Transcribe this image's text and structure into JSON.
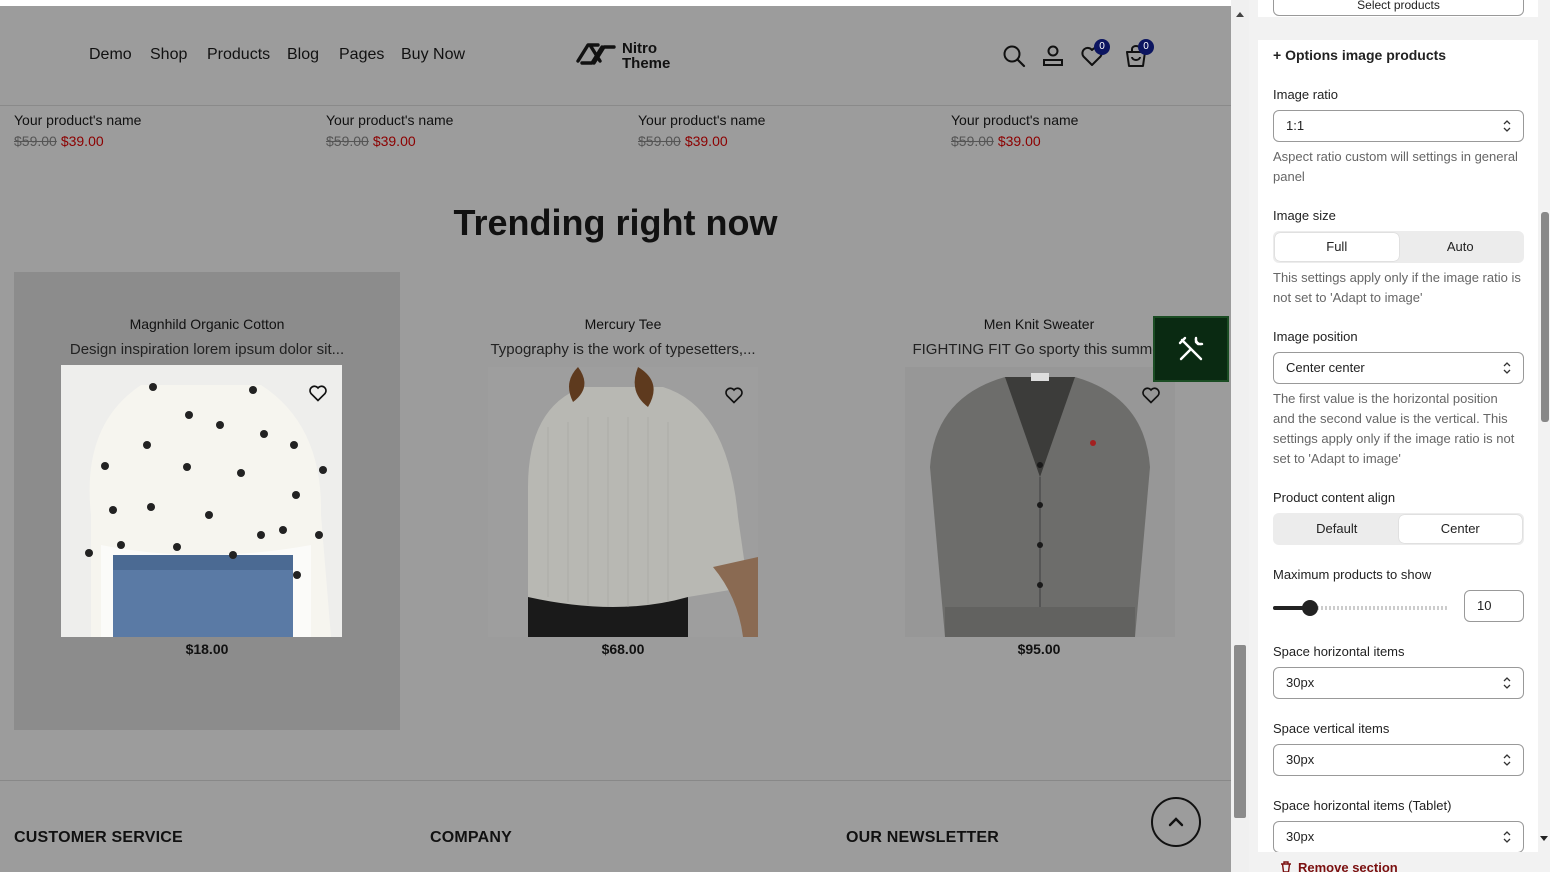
{
  "header": {
    "nav": [
      "Demo",
      "Shop",
      "Products",
      "Blog",
      "Pages",
      "Buy Now"
    ],
    "logo_line1": "Nitro",
    "logo_line2": "Theme",
    "wishlist_count": "0",
    "cart_count": "0",
    "icons": [
      "search-icon",
      "account-icon",
      "wishlist-heart-icon",
      "cart-bag-icon"
    ]
  },
  "top_products": [
    {
      "name": "Your product's name",
      "old_price": "$59.00",
      "price": "$39.00"
    },
    {
      "name": "Your product's name",
      "old_price": "$59.00",
      "price": "$39.00"
    },
    {
      "name": "Your product's name",
      "old_price": "$59.00",
      "price": "$39.00"
    },
    {
      "name": "Your product's name",
      "old_price": "$59.00",
      "price": "$39.00"
    }
  ],
  "trending": {
    "title": "Trending right now",
    "products": [
      {
        "title": "Magnhild Organic Cotton",
        "desc": "Design inspiration lorem ipsum dolor sit...",
        "price": "$18.00"
      },
      {
        "title": "Mercury Tee",
        "desc": "Typography is the work of typesetters,...",
        "price": "$68.00"
      },
      {
        "title": "Men Knit Sweater",
        "desc": "FIGHTING FIT Go sporty this summer",
        "price": "$95.00"
      }
    ]
  },
  "footer": {
    "col1": "CUSTOMER SERVICE",
    "col2": "COMPANY",
    "col3": "OUR NEWSLETTER"
  },
  "panel": {
    "select_products_label": "Select products",
    "section_heading": "+ Options image products",
    "image_ratio_label": "Image ratio",
    "image_ratio_value": "1:1",
    "image_ratio_help": "Aspect ratio custom will settings in general panel",
    "image_size_label": "Image size",
    "image_size_options": [
      "Full",
      "Auto"
    ],
    "image_size_selected": "Full",
    "image_size_help": "This settings apply only if the image ratio is not set to 'Adapt to image'",
    "image_position_label": "Image position",
    "image_position_value": "Center center",
    "image_position_help": "The first value is the horizontal position and the second value is the vertical. This settings apply only if the image ratio is not set to 'Adapt to image'",
    "content_align_label": "Product content align",
    "content_align_options": [
      "Default",
      "Center"
    ],
    "content_align_selected": "Center",
    "max_products_label": "Maximum products to show",
    "max_products_value": "10",
    "space_h_label": "Space horizontal items",
    "space_h_value": "30px",
    "space_v_label": "Space vertical items",
    "space_v_value": "30px",
    "space_h_tablet_label": "Space horizontal items (Tablet)",
    "space_h_tablet_value": "30px",
    "remove_section_label": "Remove section"
  },
  "colors": {
    "sale_price": "#8c0000",
    "badge": "#0c1560",
    "tool_button": "#0a2a12"
  }
}
